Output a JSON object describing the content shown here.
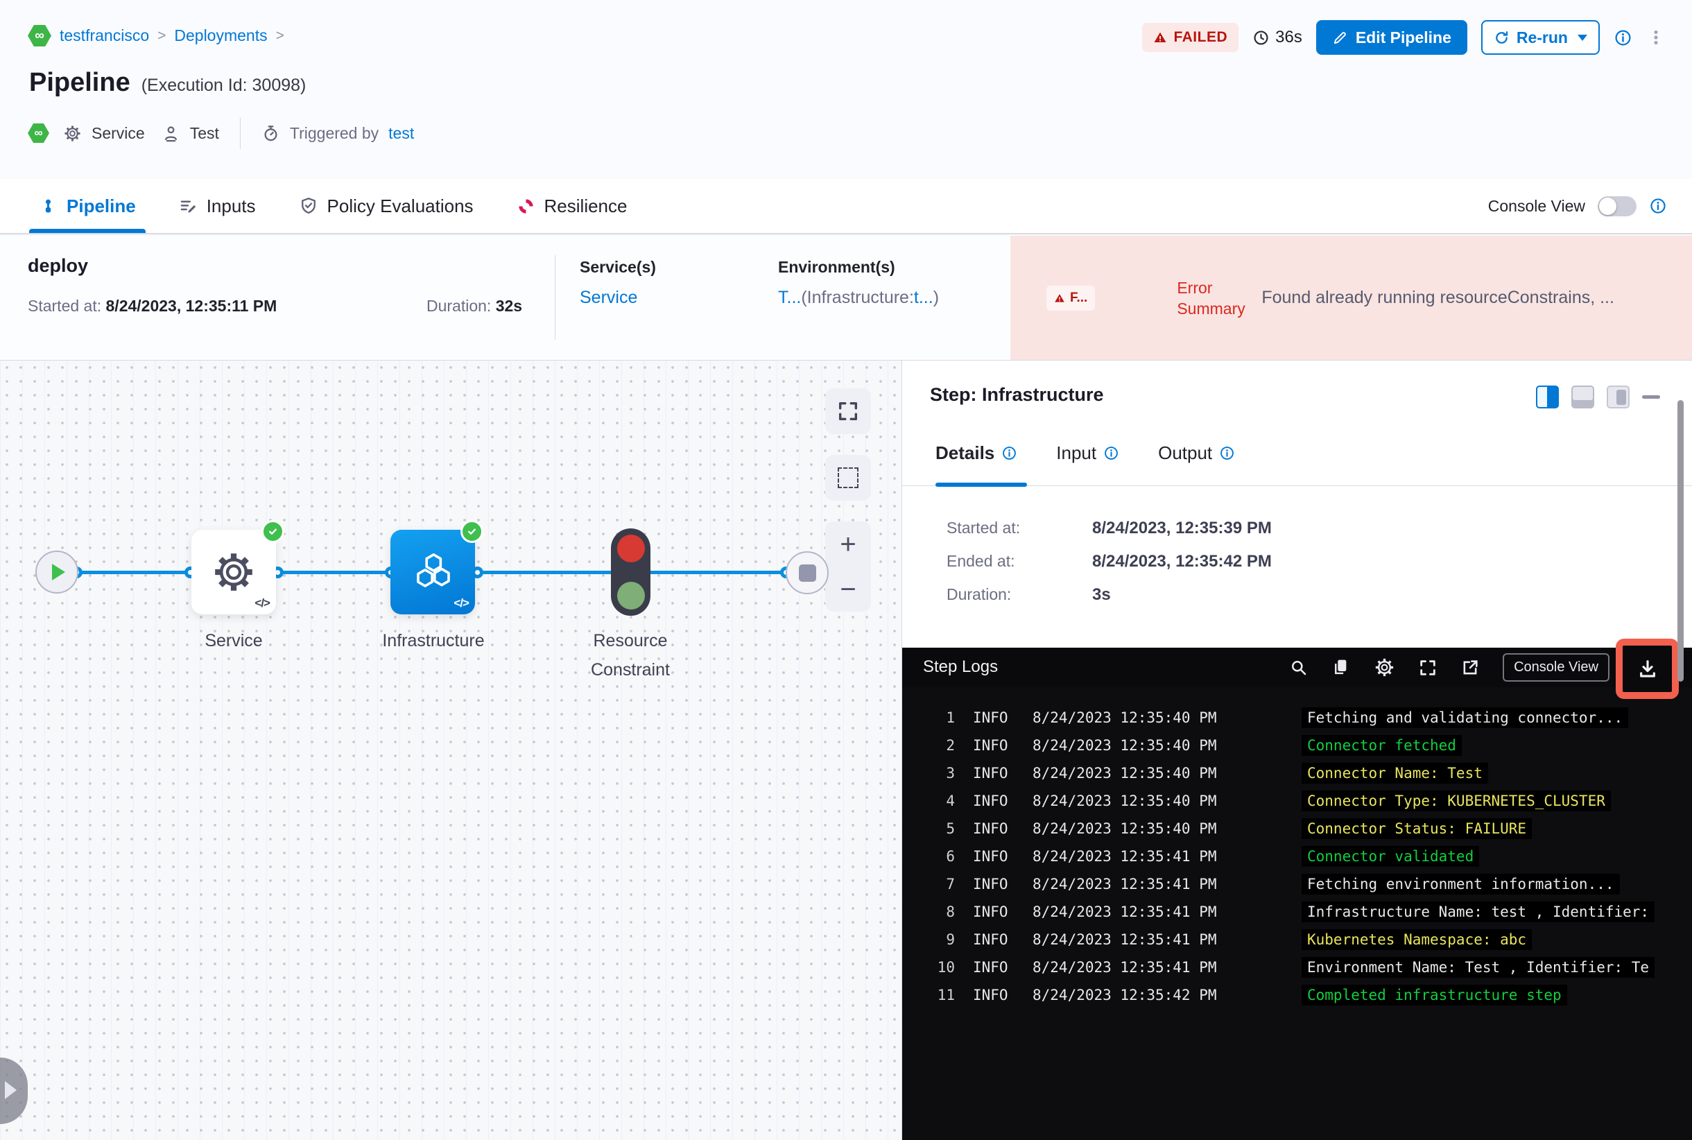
{
  "colors": {
    "primary_blue": "#0278d5",
    "failed_red": "#b8150f",
    "success_green": "#3fbf4d",
    "node_blue": "#0b8ee4",
    "resilience_pink": "#d6185e",
    "error_bg": "#f9e4e2",
    "log_green": "#12cf3f",
    "log_yellow": "#e9e55e",
    "highlight_red": "#f4604e"
  },
  "icons": {
    "logo_glyph": "∞",
    "zoom_in": "+",
    "zoom_out": "−",
    "breadcrumb_separator": ">"
  },
  "header": {
    "breadcrumb": {
      "items": [
        "testfrancisco",
        "Deployments"
      ],
      "separator": ">"
    },
    "title": "Pipeline",
    "execution_id": "(Execution Id: 30098)",
    "service_label": "Service",
    "test_label": "Test",
    "triggered_by_label": "Triggered by",
    "triggered_by_value": "test",
    "status_badge": "FAILED",
    "elapsed": "36s",
    "edit_pipeline_label": "Edit Pipeline",
    "rerun_label": "Re-run"
  },
  "tabbar": {
    "tabs": [
      {
        "label": "Pipeline"
      },
      {
        "label": "Inputs"
      },
      {
        "label": "Policy Evaluations"
      },
      {
        "label": "Resilience"
      }
    ],
    "console_view_label": "Console View"
  },
  "summary": {
    "stage_name": "deploy",
    "started_label": "Started at:",
    "started_value": "8/24/2023, 12:35:11 PM",
    "duration_label": "Duration:",
    "duration_value": "32s",
    "services_label": "Service(s)",
    "services_value": "Service",
    "environments_label": "Environment(s)",
    "env_prefix": "T...",
    "env_mid": "(Infrastructure:",
    "env_link": "t...",
    "env_suffix": ")",
    "failed_short": "F...",
    "error_summary_label": "Error Summary",
    "error_summary_text": "Found already running resourceConstrains, ..."
  },
  "canvas": {
    "code_badge": "</>",
    "nodes": {
      "service": "Service",
      "infrastructure": "Infrastructure",
      "resource_line1": "Resource",
      "resource_line2": "Constraint"
    }
  },
  "panel": {
    "title": "Step: Infrastructure",
    "tabs": [
      {
        "label": "Details"
      },
      {
        "label": "Input"
      },
      {
        "label": "Output"
      }
    ],
    "fields": [
      {
        "label": "Started at:",
        "value": "8/24/2023, 12:35:39 PM"
      },
      {
        "label": "Ended at:",
        "value": "8/24/2023, 12:35:42 PM"
      },
      {
        "label": "Duration:",
        "value": "3s"
      }
    ],
    "logs": {
      "title": "Step Logs",
      "console_view_label": "Console View",
      "entries": [
        {
          "n": 1,
          "level": "INFO",
          "time": "8/24/2023 12:35:40 PM",
          "msg": "Fetching and validating connector...",
          "color": "white"
        },
        {
          "n": 2,
          "level": "INFO",
          "time": "8/24/2023 12:35:40 PM",
          "msg": "Connector fetched",
          "color": "green"
        },
        {
          "n": 3,
          "level": "INFO",
          "time": "8/24/2023 12:35:40 PM",
          "msg": "Connector Name: Test",
          "color": "yellow"
        },
        {
          "n": 4,
          "level": "INFO",
          "time": "8/24/2023 12:35:40 PM",
          "msg": "Connector Type: KUBERNETES_CLUSTER",
          "color": "yellow"
        },
        {
          "n": 5,
          "level": "INFO",
          "time": "8/24/2023 12:35:40 PM",
          "msg": "Connector Status: FAILURE",
          "color": "yellow"
        },
        {
          "n": 6,
          "level": "INFO",
          "time": "8/24/2023 12:35:41 PM",
          "msg": "Connector validated",
          "color": "green"
        },
        {
          "n": 7,
          "level": "INFO",
          "time": "8/24/2023 12:35:41 PM",
          "msg": "Fetching environment information...",
          "color": "white"
        },
        {
          "n": 8,
          "level": "INFO",
          "time": "8/24/2023 12:35:41 PM",
          "msg": "Infrastructure Name: test , Identifier:",
          "color": "white"
        },
        {
          "n": 9,
          "level": "INFO",
          "time": "8/24/2023 12:35:41 PM",
          "msg": "Kubernetes Namespace: abc",
          "color": "yellow"
        },
        {
          "n": 10,
          "level": "INFO",
          "time": "8/24/2023 12:35:41 PM",
          "msg": "Environment Name: Test , Identifier: Te",
          "color": "white"
        },
        {
          "n": 11,
          "level": "INFO",
          "time": "8/24/2023 12:35:42 PM",
          "msg": "Completed infrastructure step",
          "color": "green"
        }
      ]
    }
  }
}
